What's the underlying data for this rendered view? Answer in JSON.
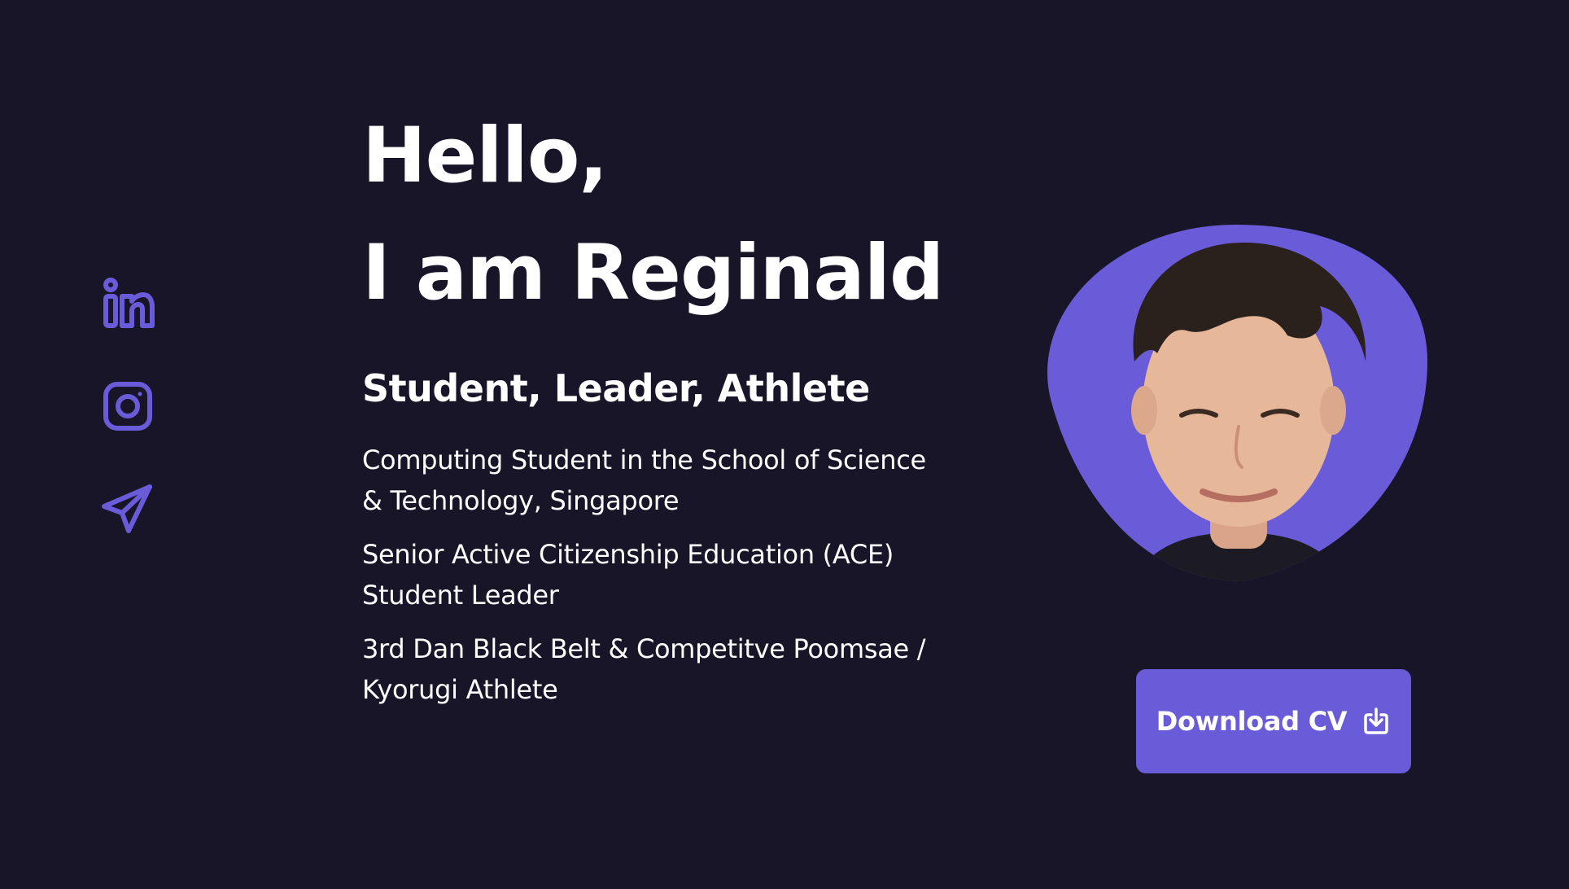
{
  "colors": {
    "background": "#181528",
    "accent": "#6a5bd8",
    "text": "#ffffff"
  },
  "social": [
    {
      "name": "LinkedIn",
      "icon": "linkedin-icon"
    },
    {
      "name": "Instagram",
      "icon": "instagram-icon"
    },
    {
      "name": "Telegram",
      "icon": "telegram-icon"
    }
  ],
  "hero": {
    "greeting": "Hello,",
    "intro": "I am Reginald",
    "tagline": "Student, Leader, Athlete",
    "bio": [
      "Computing Student in the School of Science & Technology, Singapore",
      "Senior Active Citizenship Education (ACE) Student Leader",
      "3rd Dan Black Belt & Competitve Poomsae / Kyorugi Athlete"
    ]
  },
  "avatar": {
    "icon": "profile-photo"
  },
  "cta": {
    "download_label": "Download CV",
    "icon": "download-icon"
  }
}
